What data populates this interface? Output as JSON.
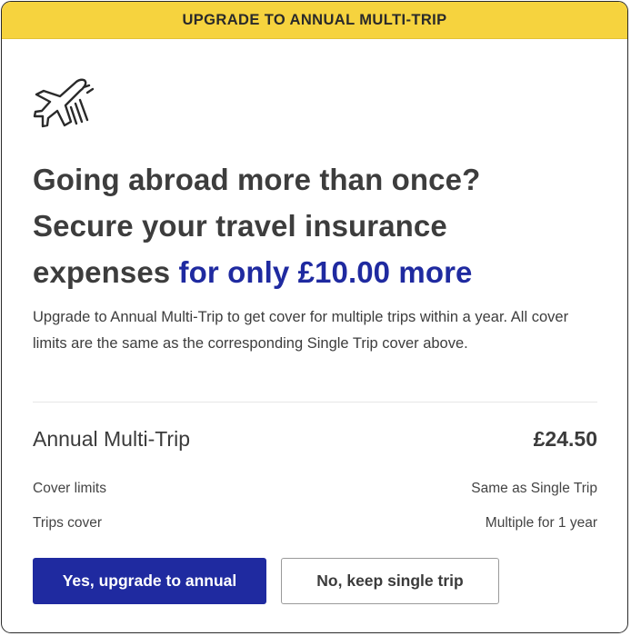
{
  "banner": {
    "text": "UPGRADE TO ANNUAL MULTI-TRIP",
    "color": "#f6d33e"
  },
  "icon": {
    "name": "airplane-icon"
  },
  "headline": {
    "line1": "Going abroad more than once?",
    "line2": "Secure your travel insurance",
    "line3_plain": "expenses ",
    "line3_accent": "for only £10.00 more",
    "accent_color": "#1f2aa0"
  },
  "description": "Upgrade to Annual Multi-Trip to get cover for multiple trips within a year. All cover limits are the same as the corresponding Single Trip cover above.",
  "product": {
    "name": "Annual Multi-Trip",
    "price": "£24.50"
  },
  "details": [
    {
      "label": "Cover limits",
      "value": "Same as Single Trip"
    },
    {
      "label": "Trips cover",
      "value": "Multiple for 1 year"
    }
  ],
  "buttons": {
    "primary": "Yes, upgrade to annual",
    "secondary": "No, keep single trip"
  }
}
